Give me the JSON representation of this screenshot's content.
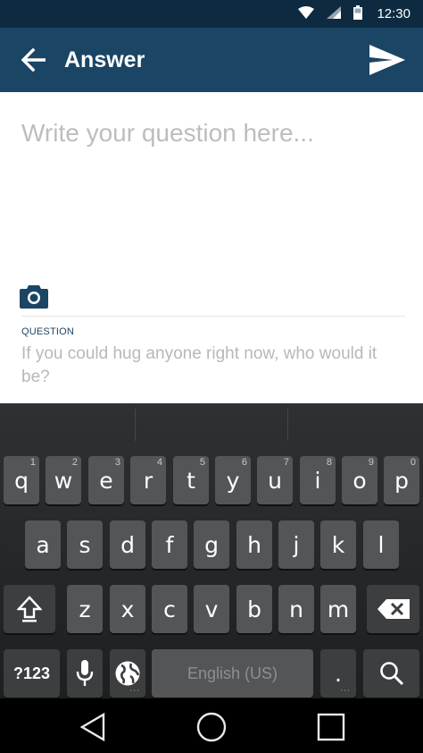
{
  "status": {
    "time": "12:30",
    "wifi_icon": "wifi-icon",
    "signal_icon": "signal-icon",
    "battery_icon": "battery-icon"
  },
  "app_bar": {
    "title": "Answer",
    "back_icon": "arrow-back-icon",
    "send_icon": "send-icon"
  },
  "compose": {
    "placeholder": "Write your question here...",
    "camera_icon": "camera-icon",
    "question_label": "QUESTION",
    "question_text": "If you could hug anyone right now, who would it be?"
  },
  "keyboard": {
    "row1": [
      {
        "key": "q",
        "hint": "1"
      },
      {
        "key": "w",
        "hint": "2"
      },
      {
        "key": "e",
        "hint": "3"
      },
      {
        "key": "r",
        "hint": "4"
      },
      {
        "key": "t",
        "hint": "5"
      },
      {
        "key": "y",
        "hint": "6"
      },
      {
        "key": "u",
        "hint": "7"
      },
      {
        "key": "i",
        "hint": "8"
      },
      {
        "key": "o",
        "hint": "9"
      },
      {
        "key": "p",
        "hint": "0"
      }
    ],
    "row2": [
      "a",
      "s",
      "d",
      "f",
      "g",
      "h",
      "j",
      "k",
      "l"
    ],
    "row3": [
      "z",
      "x",
      "c",
      "v",
      "b",
      "n",
      "m"
    ],
    "symbols_label": "?123",
    "space_label": "English (US)",
    "period_label": ".",
    "shift_icon": "shift-icon",
    "backspace_icon": "backspace-icon",
    "mic_icon": "microphone-icon",
    "globe_icon": "globe-icon",
    "search_icon": "search-icon"
  },
  "nav": {
    "back_icon": "nav-back-icon",
    "home_icon": "nav-home-icon",
    "recents_icon": "nav-recents-icon"
  },
  "colors": {
    "app_bar": "#1b4565",
    "status_bar": "#0d2a40",
    "key": "#535557",
    "keyboard_bg": "#2e3032"
  }
}
